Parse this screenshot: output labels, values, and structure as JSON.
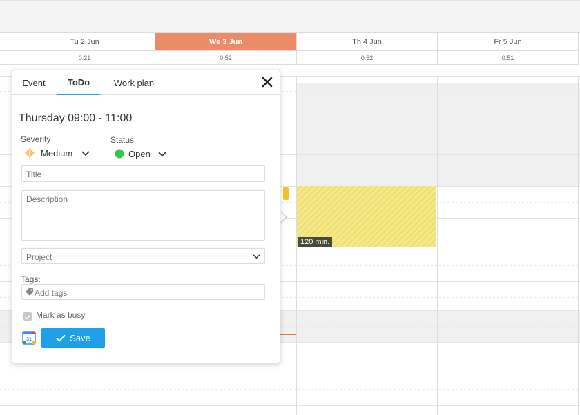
{
  "calendar": {
    "days": [
      {
        "label": "",
        "total": ""
      },
      {
        "label": "Tu 2 Jun",
        "total": "0:21"
      },
      {
        "label": "We 3 Jun",
        "total": "0:52",
        "active": true
      },
      {
        "label": "Th 4 Jun",
        "total": "0:52"
      },
      {
        "label": "Fr 5 Jun",
        "total": "0:51"
      }
    ],
    "block_label": "120 min."
  },
  "popup": {
    "tabs": [
      "Event",
      "ToDo",
      "Work plan"
    ],
    "active_tab": "ToDo",
    "when": "Thursday 09:00 - 11:00",
    "severity": {
      "label": "Severity",
      "value": "Medium"
    },
    "status": {
      "label": "Status",
      "value": "Open"
    },
    "title_placeholder": "Title",
    "description_placeholder": "Description",
    "project_placeholder": "Project",
    "tags_label": "Tags:",
    "tags_placeholder": "Add tags",
    "busy_label": "Mark as busy",
    "save_label": "Save"
  },
  "colors": {
    "accent": "#1ea0e6",
    "today": "#ec8b68",
    "severity_medium": "#f5c46b",
    "status_open": "#2ecc4a"
  }
}
